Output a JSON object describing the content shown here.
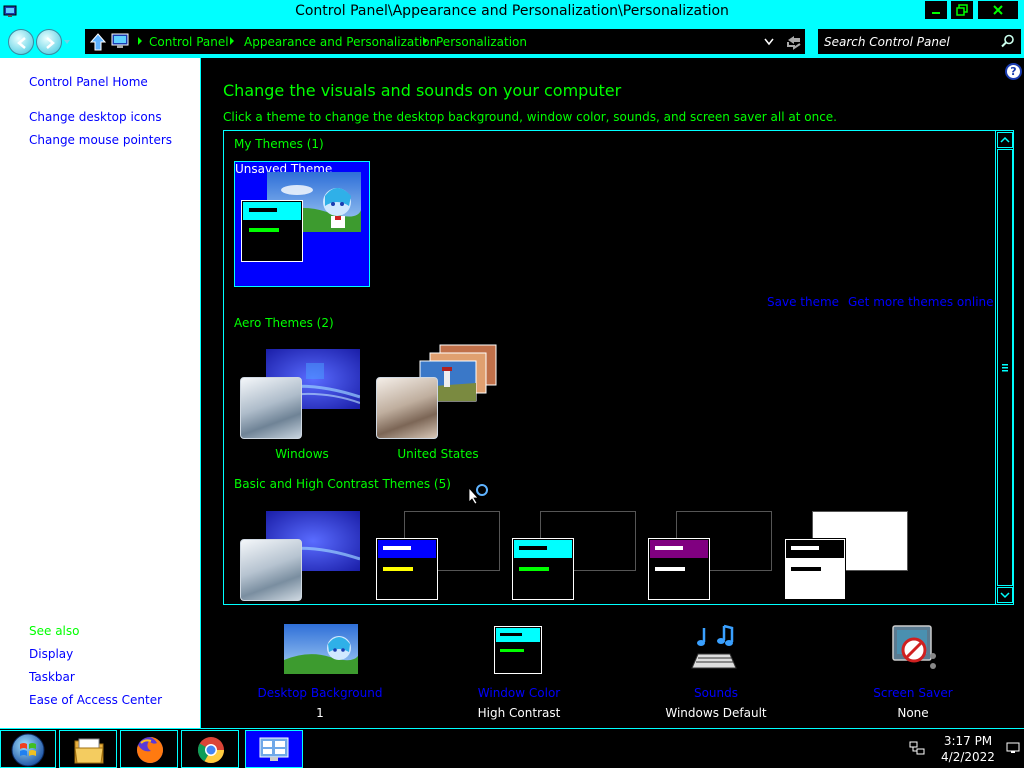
{
  "window": {
    "title": "Control Panel\\Appearance and Personalization\\Personalization"
  },
  "address": {
    "breadcrumbs": [
      "Control Panel",
      "Appearance and Personalization",
      "Personalization"
    ]
  },
  "search": {
    "placeholder": "Search Control Panel"
  },
  "sidebar": {
    "links": [
      "Control Panel Home",
      "Change desktop icons",
      "Change mouse pointers"
    ],
    "see_also_label": "See also",
    "see_also": [
      "Display",
      "Taskbar",
      "Ease of Access Center"
    ]
  },
  "main": {
    "heading": "Change the visuals and sounds on your computer",
    "subheading": "Click a theme to change the desktop background, window color, sounds, and screen saver all at once.",
    "groups": {
      "my_themes": "My Themes (1)",
      "aero_themes": "Aero Themes (2)",
      "basic_themes": "Basic and High Contrast Themes (5)"
    },
    "my_themes": [
      {
        "name": "Unsaved Theme",
        "selected": true
      }
    ],
    "aero_themes": [
      {
        "name": "Windows"
      },
      {
        "name": "United States"
      }
    ],
    "links": {
      "save_theme": "Save theme",
      "get_more": "Get more themes online"
    },
    "bottom": [
      {
        "label": "Desktop Background",
        "value": "1",
        "icon": "desktop-background-icon"
      },
      {
        "label": "Window Color",
        "value": "High Contrast",
        "icon": "window-color-icon"
      },
      {
        "label": "Sounds",
        "value": "Windows Default",
        "icon": "sounds-icon"
      },
      {
        "label": "Screen Saver",
        "value": "None",
        "icon": "screen-saver-icon"
      }
    ]
  },
  "taskbar": {
    "time": "3:17 PM",
    "date": "4/2/2022",
    "apps": [
      "start-orb-icon",
      "file-explorer-icon",
      "firefox-icon",
      "chrome-icon",
      "control-panel-icon"
    ]
  },
  "colors": {
    "highlight": "#00ffff",
    "text_green": "#00ff00",
    "link_blue": "#0000ff",
    "background": "#000000"
  }
}
